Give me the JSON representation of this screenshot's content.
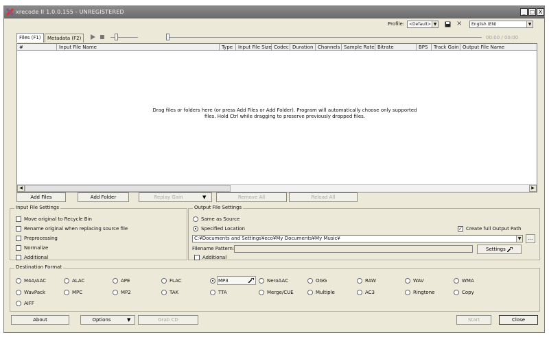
{
  "titlebar": {
    "title": "xrecode II 1.0.0.155 - UNREGISTERED",
    "minimize": "_",
    "maximize": "□",
    "close": "X"
  },
  "toolbar": {
    "profile_label": "Profile:",
    "profile_value": "<Default>",
    "language_value": "English (EN)",
    "delete_glyph": "×",
    "time": "00:00 / 00:00"
  },
  "tabs": [
    {
      "label": "Files (F1)"
    },
    {
      "label": "Metadata (F2)"
    }
  ],
  "columns": [
    "#",
    "Input File Name",
    "Type",
    "Input File Size",
    "Codec",
    "Duration",
    "Channels",
    "Sample Rate",
    "Bitrate",
    "BPS",
    "Track Gain",
    "Output File Name"
  ],
  "drop_text": {
    "line1": "Drag files or folders here (or press Add Files or Add Folder). Program will automatically choose only supported",
    "line2": "files. Hold Ctrl while dragging to preserve previously dropped files."
  },
  "actions": {
    "add_files": "Add Files",
    "add_folder": "Add Folder",
    "replay_gain": "Replay Gain",
    "remove_all": "Remove All",
    "reload_all": "Reload All"
  },
  "input_settings": {
    "title": "Input File Settings",
    "options": [
      {
        "label": "Move original to Recycle Bin",
        "checked": false
      },
      {
        "label": "Rename original when replacing source file",
        "checked": false
      },
      {
        "label": "Preprocessing",
        "checked": false
      },
      {
        "label": "Normalize",
        "checked": false
      },
      {
        "label": "Additional",
        "checked": false
      }
    ]
  },
  "output_settings": {
    "title": "Output File Settings",
    "same_as_source": "Same as Source",
    "specified_location": "Specified Location",
    "create_full_path": "Create full Output Path",
    "path": "C:¥Documents and Settings¥eco¥My Documents¥My Music¥",
    "browse": "...",
    "filename_pattern_label": "Filename Pattern:",
    "filename_pattern_value": "",
    "settings": "Settings",
    "additional": "Additional"
  },
  "destination": {
    "title": "Destination Format",
    "selected": "MP3",
    "formats": [
      "M4A/AAC",
      "ALAC",
      "APE",
      "FLAC",
      "MP3",
      "NeroAAC",
      "OGG",
      "RAW",
      "WAV",
      "WMA",
      "WavPack",
      "MPC",
      "MP2",
      "TAK",
      "TTA",
      "Merge/CUE",
      "Multiple",
      "AC3",
      "Ringtone",
      "Copy",
      "AIFF"
    ]
  },
  "bottom": {
    "about": "About",
    "options": "Options",
    "grab_cd": "Grab CD",
    "start": "Start",
    "close": "Close"
  }
}
